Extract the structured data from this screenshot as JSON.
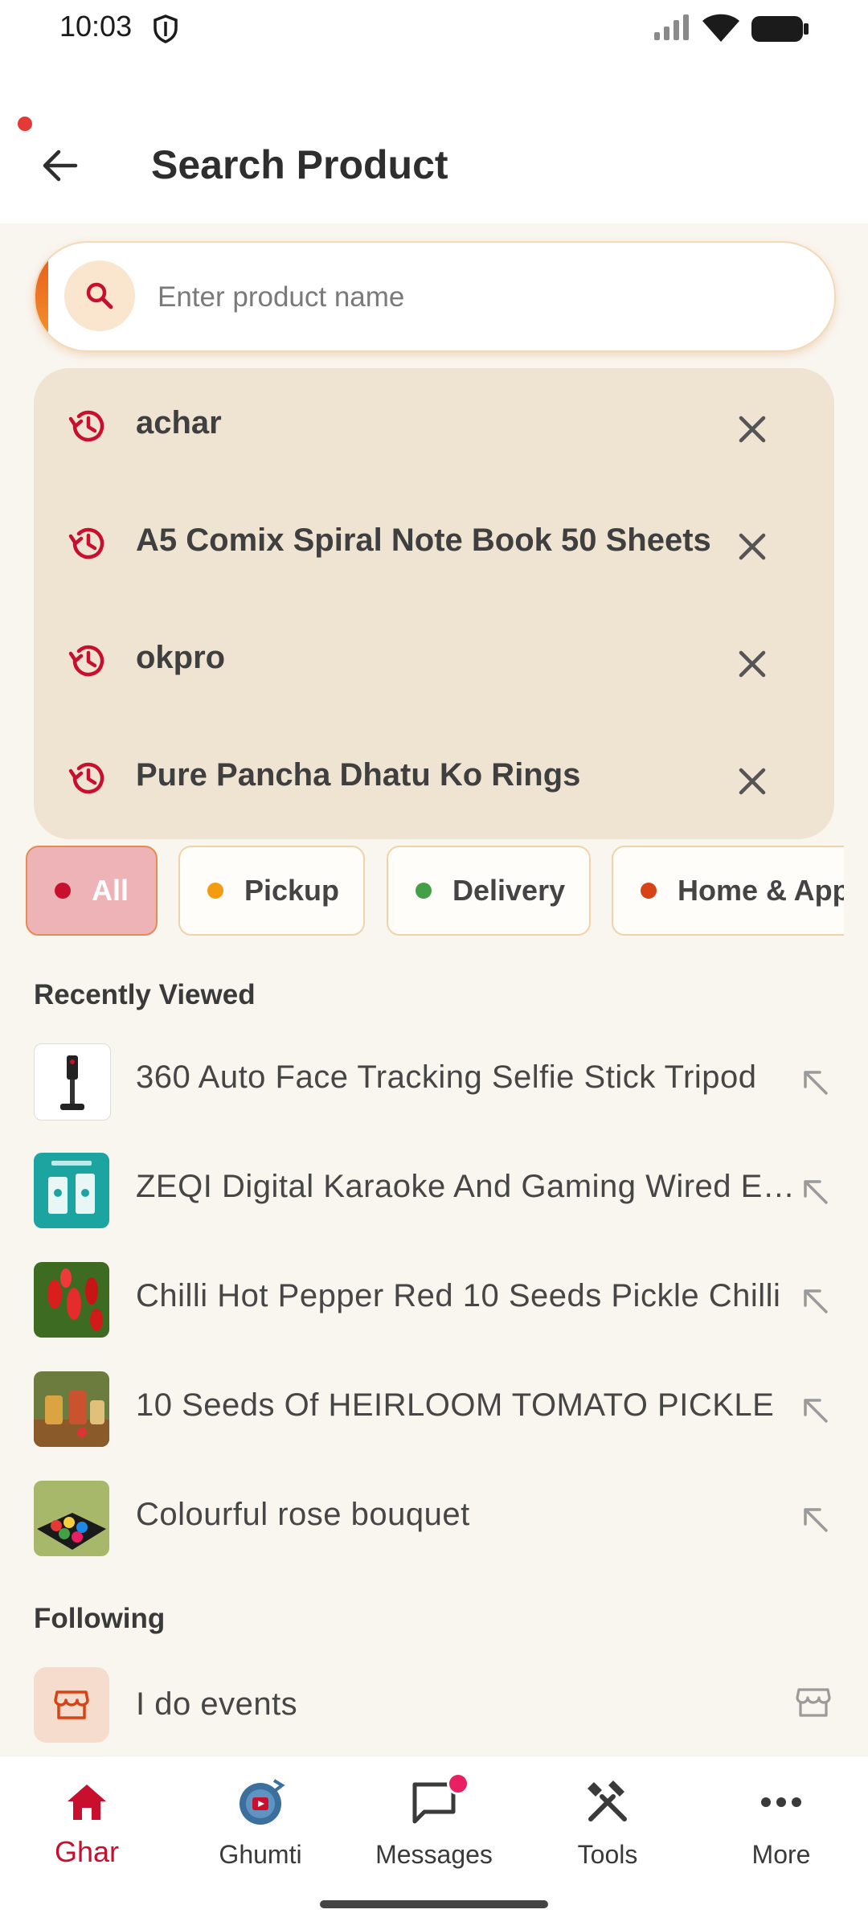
{
  "status_bar": {
    "time": "10:03"
  },
  "header": {
    "title": "Search Product"
  },
  "search": {
    "placeholder": "Enter product name",
    "value": ""
  },
  "history": [
    "achar",
    "A5 Comix Spiral Note Book 50 Sheets",
    "okpro",
    "Pure Pancha Dhatu Ko Rings"
  ],
  "filters": [
    {
      "label": "All",
      "dot_color": "#c8102e",
      "active": true
    },
    {
      "label": "Pickup",
      "dot_color": "#f39c12",
      "active": false
    },
    {
      "label": "Delivery",
      "dot_color": "#43a047",
      "active": false
    },
    {
      "label": "Home & App",
      "dot_color": "#d84315",
      "active": false
    }
  ],
  "recently_viewed": {
    "title": "Recently Viewed",
    "items": [
      "360 Auto Face Tracking Selfie Stick Tripod",
      "ZEQI Digital Karaoke And Gaming Wired Earphones",
      "Chilli Hot Pepper Red 10 Seeds Pickle Chilli",
      "10 Seeds Of HEIRLOOM TOMATO PICKLE",
      "Colourful rose bouquet"
    ]
  },
  "following": {
    "title": "Following",
    "items": [
      "I do events"
    ]
  },
  "nav": [
    {
      "label": "Ghar",
      "icon": "home-icon",
      "active": true
    },
    {
      "label": "Ghumti",
      "icon": "globe-icon",
      "active": false
    },
    {
      "label": "Messages",
      "icon": "chat-icon",
      "active": false
    },
    {
      "label": "Tools",
      "icon": "tools-icon",
      "active": false
    },
    {
      "label": "More",
      "icon": "more-icon",
      "active": false
    }
  ],
  "colors": {
    "accent": "#c8102e",
    "history_bg": "#efe3d1",
    "background": "#f9f5ef"
  }
}
